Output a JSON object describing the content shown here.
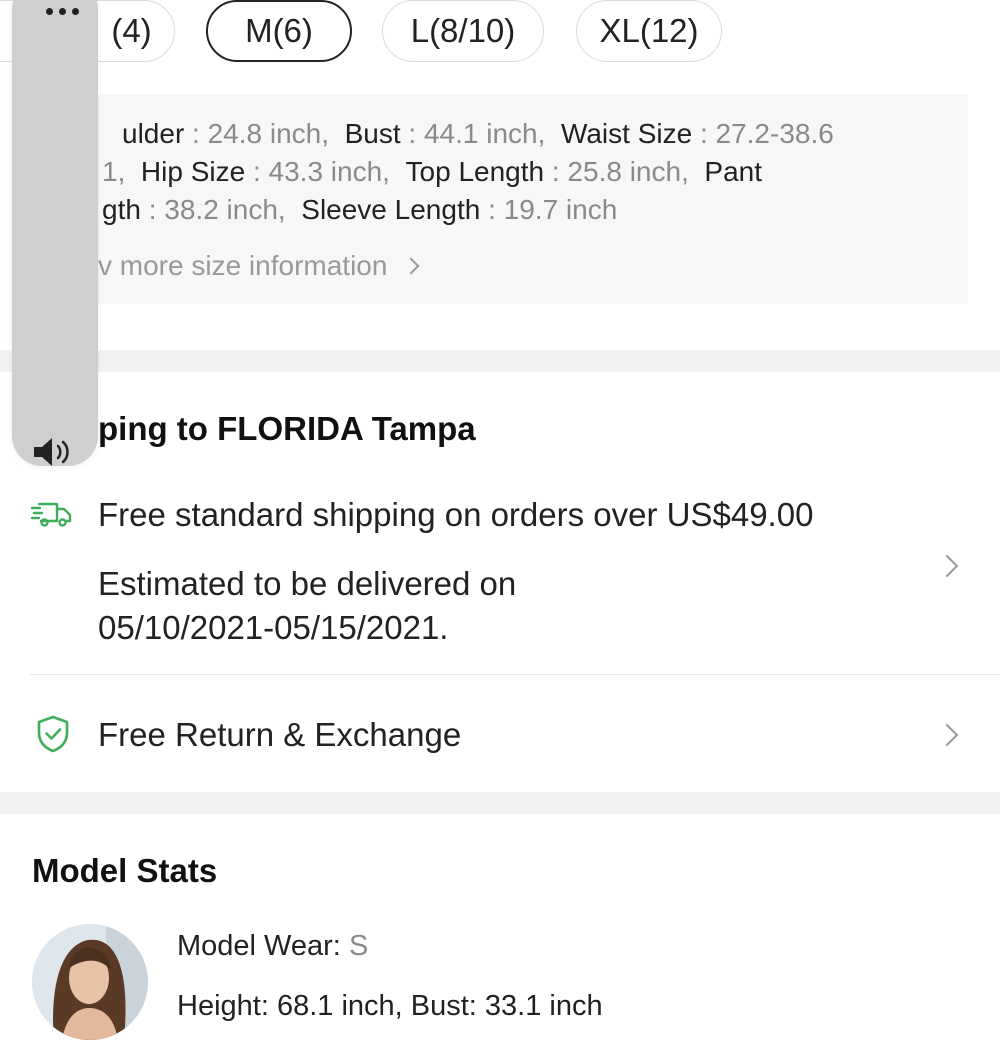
{
  "sizes": [
    {
      "label": "(4)",
      "selected": false
    },
    {
      "label": "M(6)",
      "selected": true
    },
    {
      "label": "L(8/10)",
      "selected": false
    },
    {
      "label": "XL(12)",
      "selected": false
    }
  ],
  "size_info": {
    "line1": [
      {
        "key": "ulder",
        "val": " : 24.8 inch,"
      },
      {
        "key": "Bust",
        "val": " : 44.1 inch,"
      },
      {
        "key": "Waist Size",
        "val": " : 27.2-38.6"
      }
    ],
    "line2_prefix": "1,",
    "line2": [
      {
        "key": "Hip Size",
        "val": " : 43.3 inch,"
      },
      {
        "key": "Top Length",
        "val": " : 25.8 inch,"
      },
      {
        "key": "Pant",
        "val": ""
      }
    ],
    "line3": [
      {
        "key": "gth",
        "val": " : 38.2 inch,"
      },
      {
        "key": "Sleeve Length",
        "val": " : 19.7 inch"
      }
    ],
    "more_link": "v more size information"
  },
  "shipping": {
    "title": "ping to FLORIDA Tampa",
    "free_shipping": "Free standard shipping on orders over US$49.00",
    "estimate_line1": "Estimated to be delivered on",
    "estimate_line2": "05/10/2021-05/15/2021.",
    "return_label": "Free Return & Exchange"
  },
  "model": {
    "title": "Model Stats",
    "wear_label": "Model Wear:",
    "wear_value": "S",
    "height_partial": "Height: 68.1 inch,  Bust: 33.1 inch"
  },
  "colors": {
    "accent_green": "#3fae5a",
    "selected_border": "#222222",
    "muted_value": "#8a8a8a"
  },
  "icons": {
    "more": "more-dots-icon",
    "speaker": "speaker-icon",
    "truck": "truck-icon",
    "shield": "shield-check-icon"
  }
}
